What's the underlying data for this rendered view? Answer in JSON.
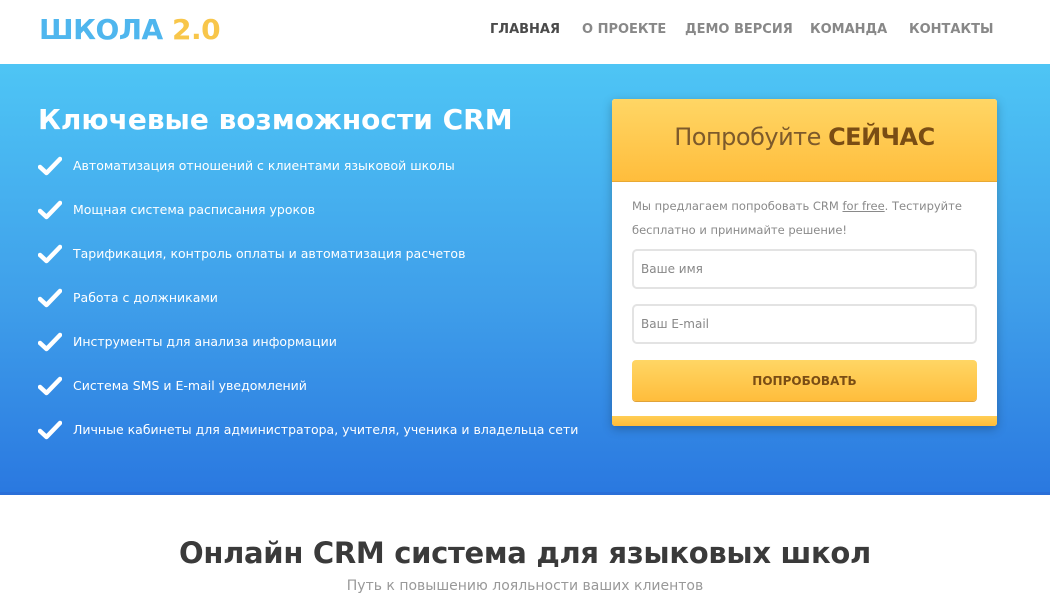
{
  "header": {
    "logo_main": "ШКОЛА",
    "logo_version": "2.0",
    "nav": [
      {
        "label": "Главная",
        "active": true
      },
      {
        "label": "О проекте",
        "active": false
      },
      {
        "label": "Демо версия",
        "active": false
      },
      {
        "label": "Команда",
        "active": false
      },
      {
        "label": "Контакты",
        "active": false
      }
    ]
  },
  "hero": {
    "title": "Ключевые возможности CRM",
    "check_icon": "checkmark-icon",
    "features": [
      "Автоматизация отношений с клиентами языковой школы",
      "Мощная система расписания уроков",
      "Тарификация, контроль оплаты и автоматизация расчетов",
      "Работа с должниками",
      "Инструменты для анализа информации",
      "Система SMS и E-mail уведомлений",
      "Личные кабинеты для администратора, учителя, ученика и владельца сети"
    ]
  },
  "signup": {
    "title_regular": "Попробуйте",
    "title_bold": "СЕЙЧАС",
    "desc_before": "Мы предлагаем попробовать CRM ",
    "desc_link": "for free",
    "desc_after": ". Тестируйте бесплатно и принимайте решение!",
    "name_placeholder": "Ваше имя",
    "email_placeholder": "Ваш E-mail",
    "submit_label": "Попробовать"
  },
  "section": {
    "title": "Онлайн CRM система для языковых школ",
    "subtitle": "Путь к повышению лояльности ваших клиентов"
  },
  "colors": {
    "brand_blue": "#4fb6ee",
    "brand_yellow": "#f8c64a",
    "hero_gradient_top": "#4ec5f5",
    "hero_gradient_bottom": "#2a78e0",
    "accent_orange": "#ffbd3c"
  }
}
